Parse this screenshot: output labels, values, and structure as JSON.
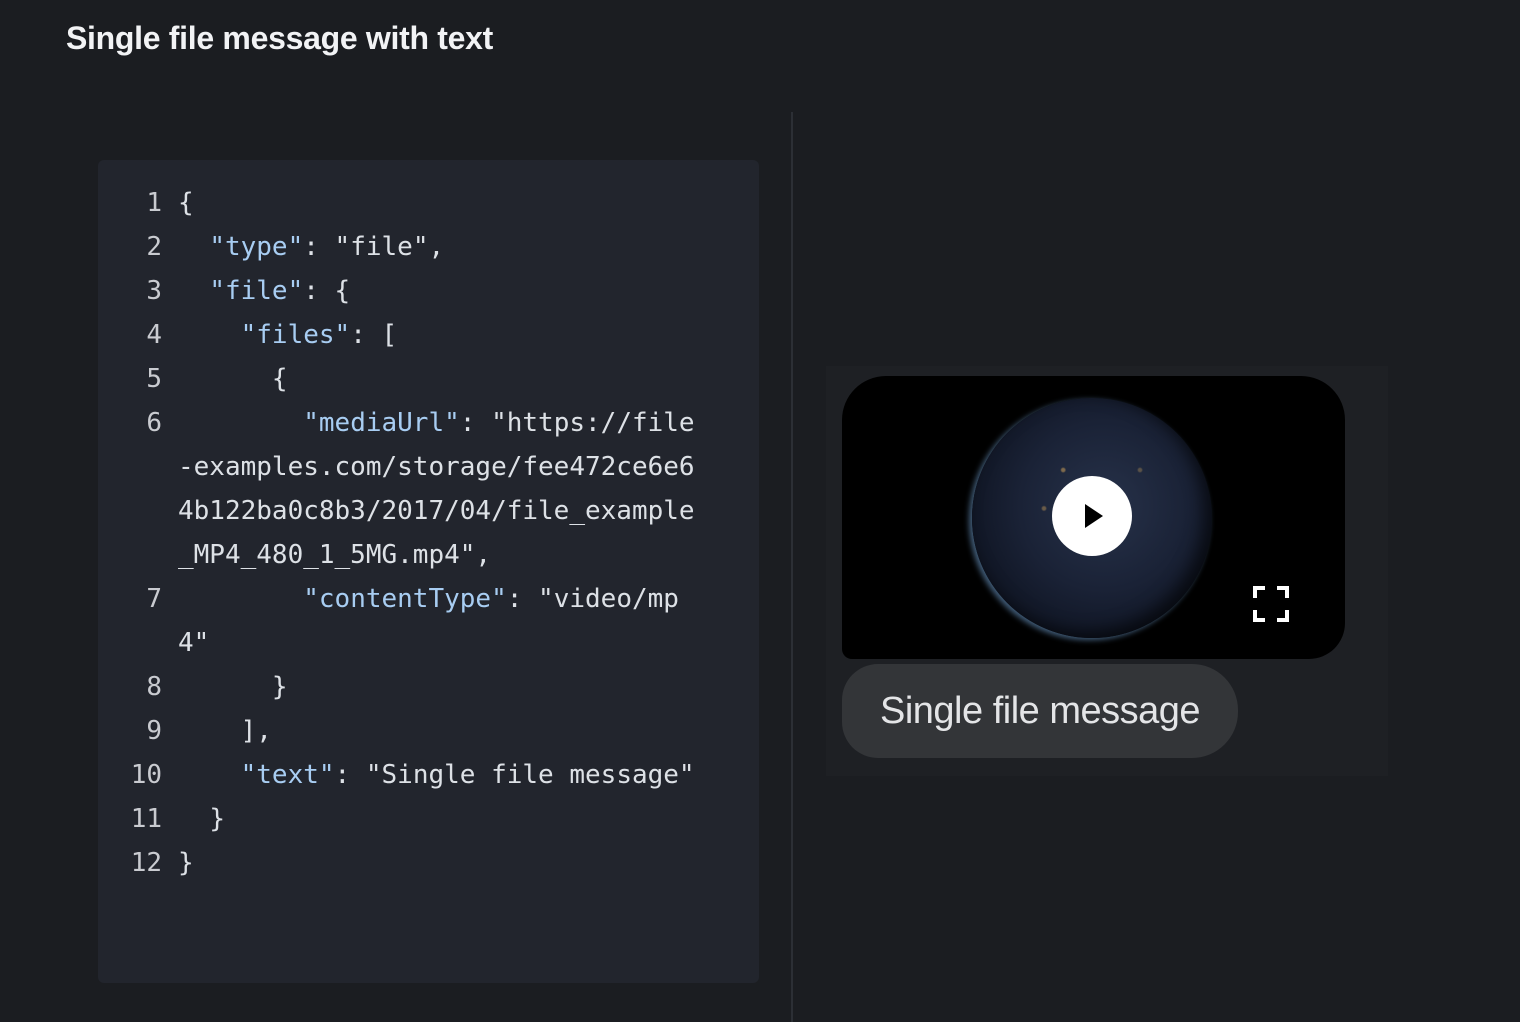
{
  "page": {
    "title": "Single file message with text"
  },
  "code": {
    "lines": [
      {
        "no": "1",
        "segments": [
          {
            "t": "{",
            "c": "punc"
          }
        ]
      },
      {
        "no": "2",
        "segments": [
          {
            "t": "  ",
            "c": "punc"
          },
          {
            "t": "\"type\"",
            "c": "key"
          },
          {
            "t": ": ",
            "c": "punc"
          },
          {
            "t": "\"file\"",
            "c": "punc"
          },
          {
            "t": ",",
            "c": "punc"
          }
        ]
      },
      {
        "no": "3",
        "segments": [
          {
            "t": "  ",
            "c": "punc"
          },
          {
            "t": "\"file\"",
            "c": "key"
          },
          {
            "t": ": {",
            "c": "punc"
          }
        ]
      },
      {
        "no": "4",
        "segments": [
          {
            "t": "    ",
            "c": "punc"
          },
          {
            "t": "\"files\"",
            "c": "key"
          },
          {
            "t": ": [",
            "c": "punc"
          }
        ]
      },
      {
        "no": "5",
        "segments": [
          {
            "t": "      {",
            "c": "punc"
          }
        ]
      },
      {
        "no": "6",
        "segments": [
          {
            "t": "        ",
            "c": "punc"
          },
          {
            "t": "\"mediaUrl\"",
            "c": "key"
          },
          {
            "t": ": ",
            "c": "punc"
          },
          {
            "t": "\"https://file-examples.com/storage/fee472ce6e64b122ba0c8b3/2017/04/file_example_MP4_480_1_5MG.mp4\"",
            "c": "punc"
          },
          {
            "t": ",",
            "c": "punc"
          }
        ]
      },
      {
        "no": "7",
        "segments": [
          {
            "t": "        ",
            "c": "punc"
          },
          {
            "t": "\"contentType\"",
            "c": "key"
          },
          {
            "t": ": ",
            "c": "punc"
          },
          {
            "t": "\"video/mp4\"",
            "c": "punc"
          }
        ]
      },
      {
        "no": "8",
        "segments": [
          {
            "t": "      }",
            "c": "punc"
          }
        ]
      },
      {
        "no": "9",
        "segments": [
          {
            "t": "    ],",
            "c": "punc"
          }
        ]
      },
      {
        "no": "10",
        "segments": [
          {
            "t": "    ",
            "c": "punc"
          },
          {
            "t": "\"text\"",
            "c": "key"
          },
          {
            "t": ": ",
            "c": "punc"
          },
          {
            "t": "\"Single file message\"",
            "c": "punc"
          }
        ]
      },
      {
        "no": "11",
        "segments": [
          {
            "t": "  }",
            "c": "punc"
          }
        ]
      },
      {
        "no": "12",
        "segments": [
          {
            "t": "}",
            "c": "punc"
          }
        ]
      }
    ]
  },
  "preview": {
    "icons": {
      "play": "play-icon",
      "fullscreen": "fullscreen-icon"
    },
    "message_text": "Single file message"
  },
  "colors": {
    "background": "#1b1d21",
    "code_background": "#22252d",
    "code_key": "#a8cdf2",
    "bubble": "#333538"
  }
}
